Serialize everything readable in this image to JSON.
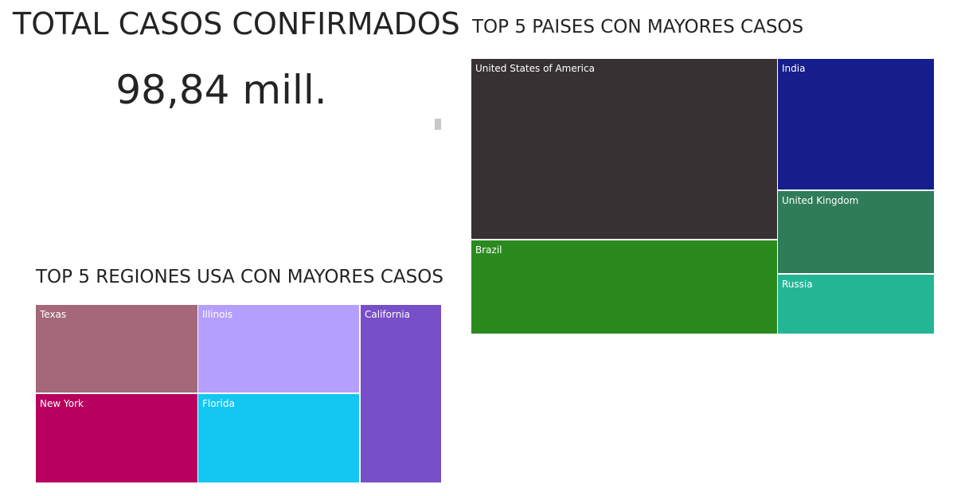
{
  "card": {
    "title": "TOTAL CASOS CONFIRMADOS",
    "value": "98,84 mill."
  },
  "countries_treemap": {
    "title": "TOP 5 PAISES CON MAYORES CASOS",
    "tiles": [
      {
        "label": "United States of America",
        "color": "#373133"
      },
      {
        "label": "Brazil",
        "color": "#2a8a1e"
      },
      {
        "label": "India",
        "color": "#161d8c"
      },
      {
        "label": "United Kingdom",
        "color": "#2f7c58"
      },
      {
        "label": "Russia",
        "color": "#24b694"
      }
    ]
  },
  "regions_treemap": {
    "title": "TOP 5 REGIONES USA CON MAYORES CASOS",
    "tiles": [
      {
        "label": "Texas",
        "color": "#a46878"
      },
      {
        "label": "New York",
        "color": "#b8005e"
      },
      {
        "label": "Illinois",
        "color": "#b49fff"
      },
      {
        "label": "Florida",
        "color": "#14c6f2"
      },
      {
        "label": "California",
        "color": "#774fc6"
      }
    ]
  }
}
